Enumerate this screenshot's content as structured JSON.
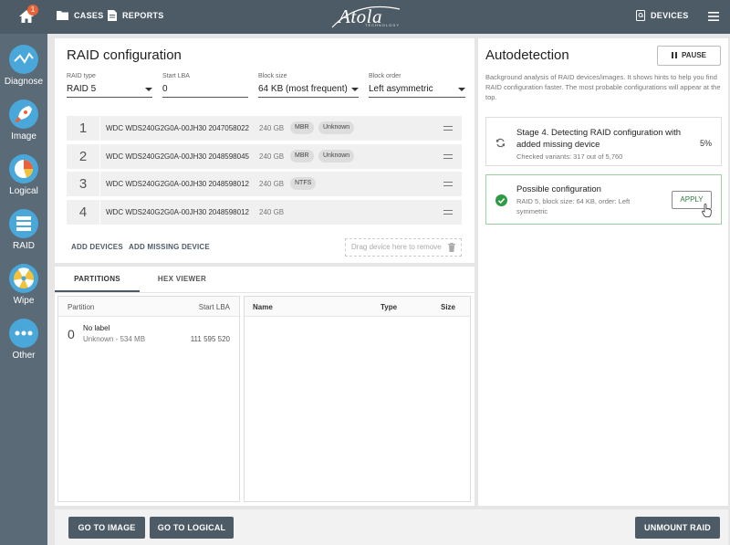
{
  "topbar": {
    "notification_count": "1",
    "cases_label": "CASES",
    "reports_label": "REPORTS",
    "logo_text": "Atola",
    "logo_subtext": "TECHNOLOGY",
    "devices_label": "DEVICES"
  },
  "sidebar": {
    "items": [
      {
        "label": "Diagnose",
        "icon": "diagnose-icon"
      },
      {
        "label": "Image",
        "icon": "rocket-icon"
      },
      {
        "label": "Logical",
        "icon": "pie-icon"
      },
      {
        "label": "RAID",
        "icon": "raid-icon"
      },
      {
        "label": "Wipe",
        "icon": "radiation-icon"
      },
      {
        "label": "Other",
        "icon": "more-icon"
      }
    ]
  },
  "raid": {
    "title": "RAID configuration",
    "fields": {
      "raid_type": {
        "label": "RAID type",
        "value": "RAID 5"
      },
      "start_lba": {
        "label": "Start LBA",
        "value": "0"
      },
      "block_size": {
        "label": "Block size",
        "value": "64 KB (most frequent)"
      },
      "block_order": {
        "label": "Block order",
        "value": "Left asymmetric"
      }
    },
    "devices": [
      {
        "num": "1",
        "name": "WDC WDS240G2G0A-00JH30 2047058022",
        "size": "240 GB",
        "chips": [
          "MBR",
          "Unknown"
        ]
      },
      {
        "num": "2",
        "name": "WDC WDS240G2G0A-00JH30 2048598045",
        "size": "240 GB",
        "chips": [
          "MBR",
          "Unknown"
        ]
      },
      {
        "num": "3",
        "name": "WDC WDS240G2G0A-00JH30 2048598012",
        "size": "240 GB",
        "chips": [
          "NTFS"
        ]
      },
      {
        "num": "4",
        "name": "WDC WDS240G2G0A-00JH30 2048598012",
        "size": "240 GB",
        "chips": []
      }
    ],
    "add_devices_label": "ADD DEVICES",
    "add_missing_label": "ADD MISSING DEVICE",
    "drop_zone_text": "Drag device here to remove"
  },
  "tabs": {
    "partitions": "PARTITIONS",
    "hex_viewer": "HEX VIEWER"
  },
  "partitions": {
    "headers": {
      "partition": "Partition",
      "start_lba": "Start LBA"
    },
    "rows": [
      {
        "num": "0",
        "label": "No label",
        "detail": "Unknown - 534 MB",
        "start": "111 595 520"
      }
    ]
  },
  "files": {
    "headers": {
      "name": "Name",
      "type": "Type",
      "size": "Size"
    }
  },
  "autodetect": {
    "title": "Autodetection",
    "pause_label": "PAUSE",
    "description": "Background analysis of RAID devices/images. It shows hints to help you find RAID configuration faster. The most probable configurations will appear at the top.",
    "stage": {
      "title": "Stage 4. Detecting RAID configuration with added missing device",
      "percent": "5%",
      "detail": "Checked variants: 317 out of 5,760"
    },
    "possible": {
      "title": "Possible configuration",
      "detail": "RAID 5, block size: 64 KB, order: Left symmetric",
      "apply_label": "APPLY"
    }
  },
  "bottom": {
    "go_image": "GO TO IMAGE",
    "go_logical": "GO TO LOGICAL",
    "unmount": "UNMOUNT RAID"
  },
  "colors": {
    "topbar": "#4d5b67",
    "sidebar": "#5a6a77",
    "accent_green": "#2f9a44",
    "badge": "#e8623a"
  }
}
